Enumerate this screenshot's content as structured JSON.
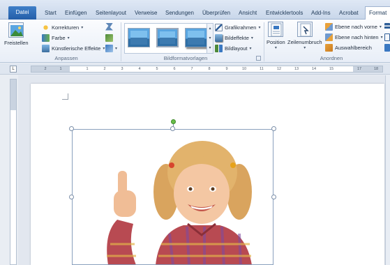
{
  "tabs": [
    {
      "label": "Datei"
    },
    {
      "label": "Start"
    },
    {
      "label": "Einfügen"
    },
    {
      "label": "Seitenlayout"
    },
    {
      "label": "Verweise"
    },
    {
      "label": "Sendungen"
    },
    {
      "label": "Überprüfen"
    },
    {
      "label": "Ansicht"
    },
    {
      "label": "Entwicklertools"
    },
    {
      "label": "Add-Ins"
    },
    {
      "label": "Acrobat"
    },
    {
      "label": "Format"
    }
  ],
  "ribbon": {
    "anpassen": {
      "freistellen": "Freistellen",
      "korrekturen": "Korrekturen",
      "farbe": "Farbe",
      "kuenstlerische_effekte": "Künstlerische Effekte",
      "group_label": "Anpassen"
    },
    "bildformatvorlagen": {
      "grafikrahmen": "Grafikrahmen",
      "bildeffekte": "Bildeffekte",
      "bildlayout": "Bildlayout",
      "group_label": "Bildformatvorlagen"
    },
    "anordnen": {
      "position": "Position",
      "zeilenumbruch": "Zeilenumbruch",
      "ebene_vorne": "Ebene nach vorne",
      "ebene_hinten": "Ebene nach hinten",
      "auswahlbereich": "Auswahlbereich",
      "group_label": "Anordnen"
    }
  },
  "ruler": {
    "corner": "L",
    "ticks": [
      "2",
      "1",
      "1",
      "2",
      "3",
      "4",
      "5",
      "6",
      "7",
      "8",
      "9",
      "10",
      "11",
      "12",
      "13",
      "14",
      "15",
      "17",
      "18"
    ]
  },
  "document": {
    "image_description": "child giving thumbs up"
  },
  "colors": {
    "accent": "#245ea8",
    "ribbon_bg": "#e8eef7",
    "page": "#ffffff"
  }
}
